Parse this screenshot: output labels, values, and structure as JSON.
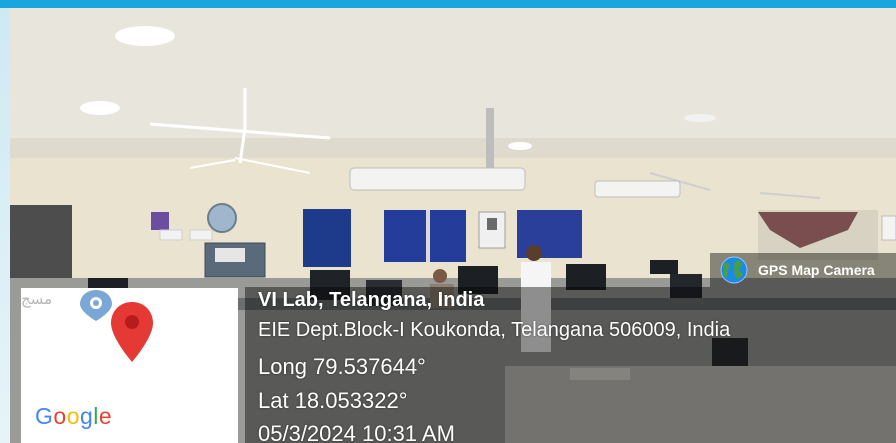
{
  "overlay": {
    "title": "VI Lab, Telangana, India",
    "address": "EIE Dept.Block-I Koukonda, Telangana 506009, India",
    "longitude": "Long 79.537644°",
    "latitude": "Lat 18.053322°",
    "timestamp": "05/3/2024 10:31 AM"
  },
  "badge": {
    "label": "GPS Map Camera"
  },
  "map": {
    "place_label": "مسج",
    "logo_letters": [
      "G",
      "o",
      "o",
      "g",
      "l",
      "e"
    ],
    "logo_colors": [
      "#4285F4",
      "#EA4335",
      "#FBBC05",
      "#4285F4",
      "#34A853",
      "#EA4335"
    ],
    "pin_color": "#e53935",
    "place_pin_color": "#7aa7d6"
  },
  "colors": {
    "frame_accent": "#19a6de",
    "caption_text": "#ffffff"
  }
}
